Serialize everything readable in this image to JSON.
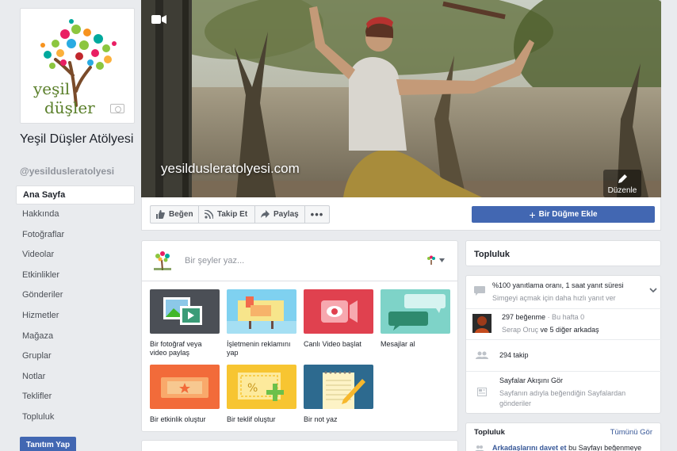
{
  "page": {
    "name": "Yeşil Düşler Atölyesi",
    "handle": "@yesildusleratolyesi",
    "logo_text_1": "yeşil",
    "logo_text_2": "düşler"
  },
  "left_nav": {
    "items": [
      {
        "label": "Ana Sayfa",
        "active": true
      },
      {
        "label": "Hakkında"
      },
      {
        "label": "Fotoğraflar"
      },
      {
        "label": "Videolar"
      },
      {
        "label": "Etkinlikler"
      },
      {
        "label": "Gönderiler"
      },
      {
        "label": "Hizmetler"
      },
      {
        "label": "Mağaza"
      },
      {
        "label": "Gruplar"
      },
      {
        "label": "Notlar"
      },
      {
        "label": "Teklifler"
      },
      {
        "label": "Topluluk"
      }
    ],
    "promote_label": "Tanıtım Yap"
  },
  "cover": {
    "watermark_text": "yesildusleratolyesi.com",
    "edit_label": "Düzenle"
  },
  "action_bar": {
    "like_label": "Beğen",
    "follow_label": "Takip Et",
    "share_label": "Paylaş",
    "more_label": "•••",
    "cta_label": "Bir Düğme Ekle"
  },
  "composer": {
    "placeholder": "Bir şeyler yaz...",
    "tiles": [
      {
        "label": "Bir fotoğraf veya video paylaş"
      },
      {
        "label": "İşletmenin reklamını yap"
      },
      {
        "label": "Canlı Video başlat"
      },
      {
        "label": "Mesajlar al"
      },
      {
        "label": "Bir etkinlik oluştur"
      },
      {
        "label": "Bir teklif oluştur"
      },
      {
        "label": "Bir not yaz"
      }
    ]
  },
  "community": {
    "title": "Topluluk",
    "response_rate": "%100 yanıtlama oranı, 1 saat yanıt süresi",
    "response_sub": "Simgeyi açmak için daha hızlı yanıt ver",
    "likes": "297 beğenme",
    "likes_week": "· Bu hafta 0",
    "liked_by_name": "Serap Oruç",
    "liked_by_rest": "ve 5 diğer arkadaş",
    "followers": "294 takip",
    "feed_title": "Sayfalar Akışını Gör",
    "feed_sub": "Sayfanın adıyla beğendiğin Sayfalardan gönderiler"
  },
  "community2": {
    "title": "Topluluk",
    "see_all": "Tümünü Gör",
    "invite_link": "Arkadaşlarını davet et",
    "invite_rest": "bu Sayfayı beğenmeye"
  },
  "colors": {
    "brand_blue": "#4267b2",
    "link_blue": "#385898",
    "background": "#e9ebee"
  }
}
